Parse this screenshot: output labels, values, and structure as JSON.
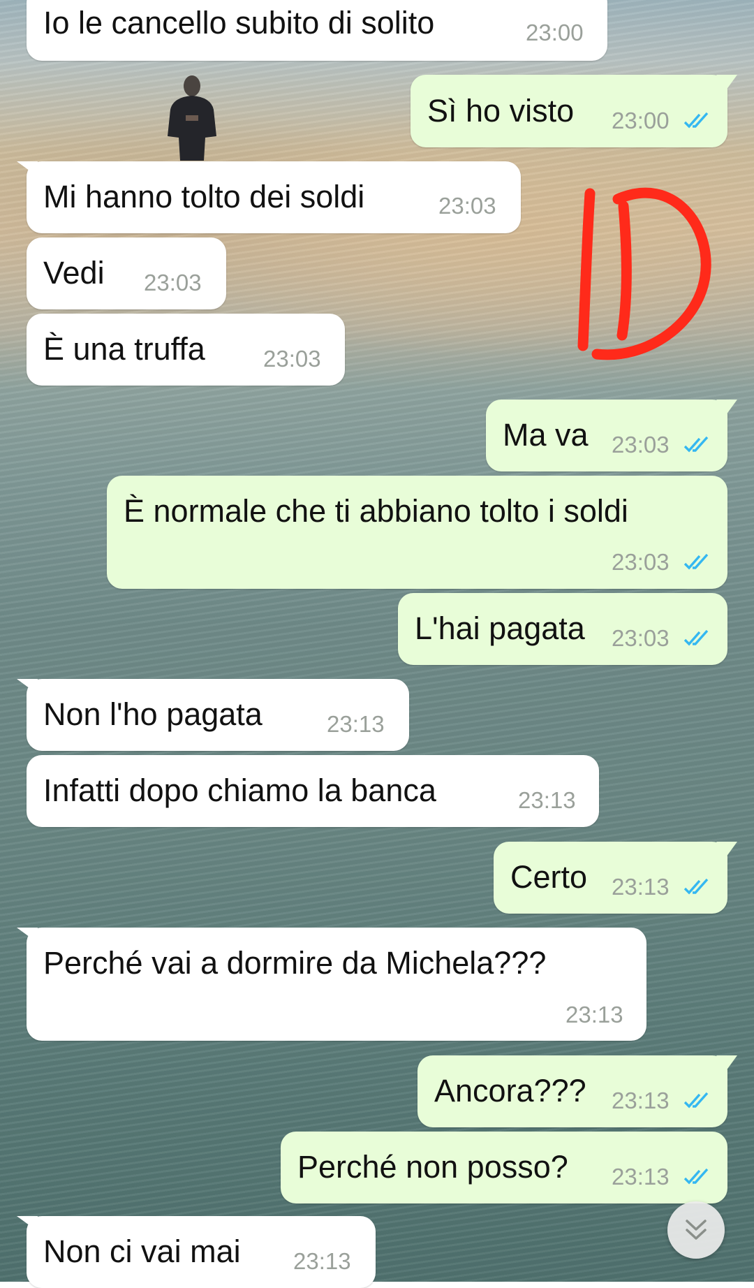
{
  "messages": [
    {
      "text": "Io le cancello subito di solito",
      "time": "23:00",
      "direction": "incoming"
    },
    {
      "text": "Sì ho visto",
      "time": "23:00",
      "direction": "outgoing",
      "status": "read"
    },
    {
      "text": "Mi hanno tolto dei soldi",
      "time": "23:03",
      "direction": "incoming"
    },
    {
      "text": "Vedi",
      "time": "23:03",
      "direction": "incoming"
    },
    {
      "text": "È una truffa",
      "time": "23:03",
      "direction": "incoming"
    },
    {
      "text": "Ma va",
      "time": "23:03",
      "direction": "outgoing",
      "status": "read"
    },
    {
      "text": "È normale che ti abbiano tolto i soldi",
      "time": "23:03",
      "direction": "outgoing",
      "status": "read"
    },
    {
      "text": "L'hai pagata",
      "time": "23:03",
      "direction": "outgoing",
      "status": "read"
    },
    {
      "text": "Non l'ho pagata",
      "time": "23:13",
      "direction": "incoming"
    },
    {
      "text": "Infatti dopo chiamo la banca",
      "time": "23:13",
      "direction": "incoming"
    },
    {
      "text": "Certo",
      "time": "23:13",
      "direction": "outgoing",
      "status": "read"
    },
    {
      "text": "Perché vai a dormire da Michela???",
      "time": "23:13",
      "direction": "incoming"
    },
    {
      "text": "Ancora???",
      "time": "23:13",
      "direction": "outgoing",
      "status": "read"
    },
    {
      "text": "Perché non posso?",
      "time": "23:13",
      "direction": "outgoing",
      "status": "read"
    },
    {
      "text": "Non ci vai mai",
      "time": "23:13",
      "direction": "incoming"
    }
  ],
  "scroll_button": {
    "icon": "double-chevron-down-icon"
  },
  "colors": {
    "incoming_bubble": "#ffffff",
    "outgoing_bubble": "#e8fdd8",
    "read_ticks": "#34b7f1",
    "annotation": "#ff2a1a"
  }
}
